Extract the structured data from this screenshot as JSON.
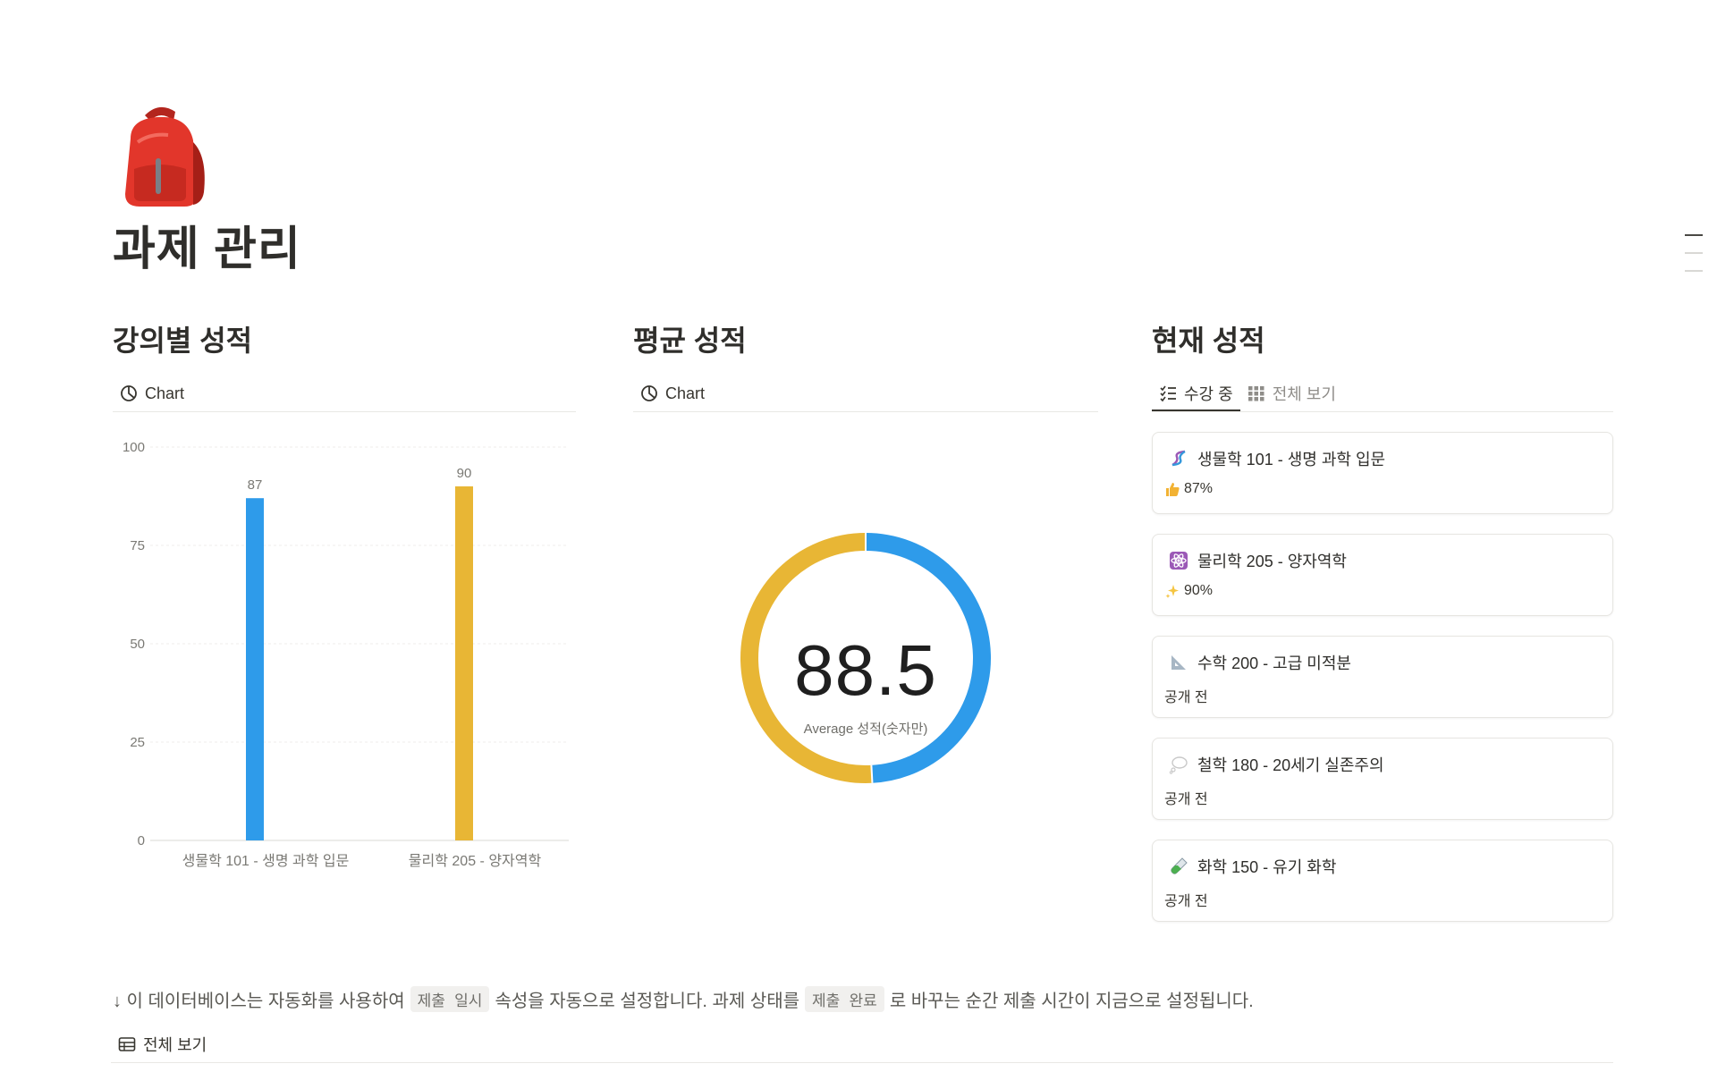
{
  "page": {
    "title": "과제 관리",
    "icon": "backpack-icon"
  },
  "sections": {
    "course_grades": {
      "title": "강의별 성적",
      "view_tab": "Chart",
      "view_icon": "chart-icon"
    },
    "average_grade": {
      "title": "평균 성적",
      "view_tab": "Chart",
      "view_icon": "chart-icon",
      "value_text": "88.5",
      "value_label": "Average 성적(숫자만)"
    },
    "current_grades": {
      "title": "현재 성적",
      "tabs": [
        {
          "label": "수강 중",
          "icon": "checklist-icon",
          "active": true
        },
        {
          "label": "전체 보기",
          "icon": "gallery-grid-icon",
          "active": false
        }
      ],
      "cards": [
        {
          "title": "생물학 101 - 생명 과학 입문",
          "icon": "dna-icon",
          "status": "87%",
          "status_icon": "thumbs-up-icon"
        },
        {
          "title": "물리학 205 - 양자역학",
          "icon": "atom-icon",
          "status": "90%",
          "status_icon": "sparkles-icon"
        },
        {
          "title": "수학 200 - 고급 미적분",
          "icon": "triangle-ruler-icon",
          "status": "공개 전",
          "status_icon": ""
        },
        {
          "title": "철학 180 - 20세기 실존주의",
          "icon": "thought-bubble-icon",
          "status": "공개 전",
          "status_icon": ""
        },
        {
          "title": "화학 150 - 유기 화학",
          "icon": "test-tube-icon",
          "status": "공개 전",
          "status_icon": ""
        }
      ]
    }
  },
  "chart_data": [
    {
      "type": "bar",
      "categories": [
        "생물학 101 - 생명 과학 입문",
        "물리학 205 - 양자역학"
      ],
      "values": [
        87,
        90
      ],
      "colors": [
        "#2e9bea",
        "#e8b635"
      ],
      "y_ticks": [
        0,
        25,
        50,
        75,
        100
      ],
      "ylim": [
        0,
        100
      ],
      "grid": true,
      "data_labels": true
    },
    {
      "type": "pie",
      "variant": "donut",
      "categories": [
        "물리학 205 - 양자역학",
        "생물학 101 - 생명 과학 입문"
      ],
      "values": [
        90,
        87
      ],
      "colors": [
        "#e8b635",
        "#2e9bea"
      ],
      "center_value": 88.5
    }
  ],
  "footer": {
    "note_prefix": "↓ 이 데이터베이스는 자동화를 사용하여",
    "note_code1": "제출 일시",
    "note_mid": "속성을 자동으로 설정합니다. 과제 상태를",
    "note_code2": "제출 완료",
    "note_suffix": "로 바꾸는 순간 제출 시간이 지금으로 설정됩니다.",
    "view_tab": "전체 보기",
    "view_icon": "table-icon"
  },
  "colors": {
    "blue": "#2e9bea",
    "yellow": "#e8b635",
    "text": "#37352f"
  }
}
